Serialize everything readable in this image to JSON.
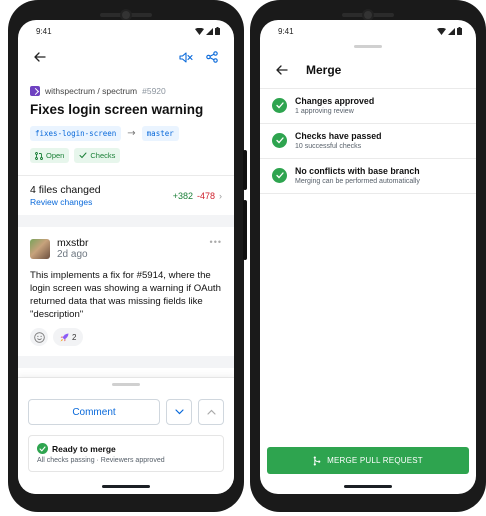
{
  "left": {
    "status": {
      "time": "9:41"
    },
    "repo": {
      "owner_name": "withspectrum / spectrum",
      "number": "#5920"
    },
    "pr": {
      "title": "Fixes login screen warning",
      "head_branch": "fixes-login-screen",
      "base_branch": "master"
    },
    "badges": {
      "state": "Open",
      "checks": "Checks"
    },
    "files": {
      "title": "4 files changed",
      "link": "Review changes",
      "additions": "+382",
      "deletions": "-478"
    },
    "comment": {
      "author": "mxstbr",
      "time": "2d ago",
      "body": "This implements a fix for #5914, where the login screen was showing a warning if OAuth returned data that was missing fields like \"description\"",
      "reaction_count": "2"
    },
    "sheet": {
      "comment_label": "Comment",
      "merge_title": "Ready to merge",
      "merge_sub": "All checks passing · Reviewers approved"
    }
  },
  "right": {
    "status": {
      "time": "9:41"
    },
    "title": "Merge",
    "requirements": [
      {
        "title": "Changes approved",
        "sub": "1 approving review"
      },
      {
        "title": "Checks have passed",
        "sub": "10 successful checks"
      },
      {
        "title": "No conflicts with base branch",
        "sub": "Merging can be performed automatically"
      }
    ],
    "merge_button": "MERGE PULL REQUEST"
  },
  "icons": {
    "back": "arrow-left-icon",
    "mute": "mute-icon",
    "share": "share-icon",
    "check": "check-icon",
    "merge": "merge-icon"
  },
  "colors": {
    "accent": "#0969da",
    "success": "#2ea44f",
    "danger": "#cf222e",
    "repo_logo": "#6f42c1"
  }
}
